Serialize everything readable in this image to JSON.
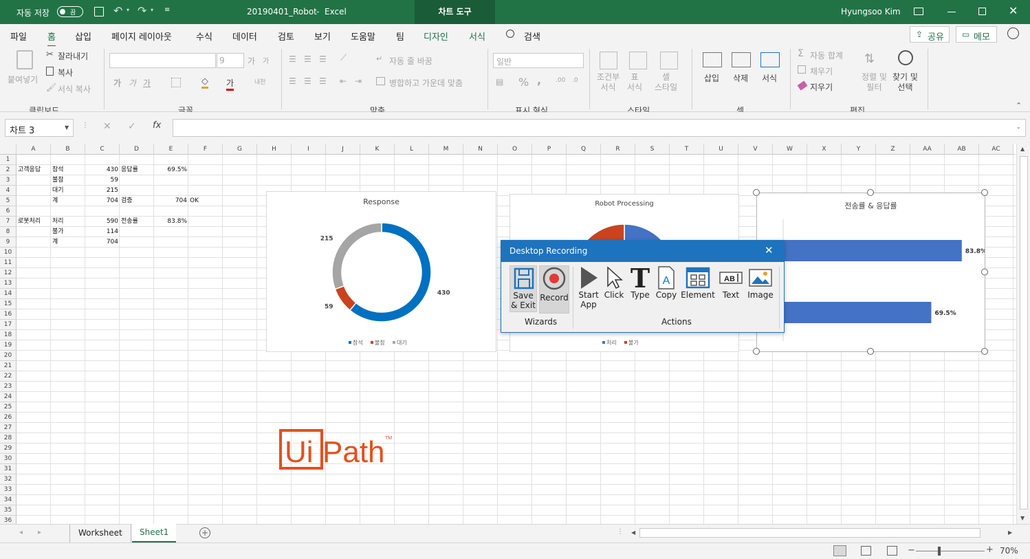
{
  "titlebar": {
    "autosave_label": "자동 저장",
    "autosave_state": "끔",
    "filename": "20190401_Robot",
    "separator": "-",
    "app": "Excel",
    "context_tab": "차트 도구",
    "user": "Hyungsoo Kim"
  },
  "menu": {
    "tabs": [
      "파일",
      "홈",
      "삽입",
      "페이지 레이아웃",
      "수식",
      "데이터",
      "검토",
      "보기",
      "도움말",
      "팀",
      "디자인",
      "서식"
    ],
    "search": "검색",
    "share": "공유",
    "memo": "메모"
  },
  "ribbon": {
    "clipboard": {
      "paste": "붙여넣기",
      "cut": "잘라내기",
      "copy": "복사",
      "format_painter": "서식 복사",
      "group": "클립보드"
    },
    "font": {
      "size": "9",
      "grow": "가",
      "shrink": "가",
      "bold": "가",
      "italic": "가",
      "underline": "가",
      "ruby": "내천",
      "font_color": "가",
      "group": "글꼴"
    },
    "alignment": {
      "wrap": "자동 줄 바꿈",
      "merge": "병합하고 가운데 맞춤",
      "group": "맞춤"
    },
    "number": {
      "format": "일반",
      "percent": "%",
      "comma": ",",
      "group": "표시 형식"
    },
    "styles": {
      "conditional": "조건부\n서식",
      "table": "표\n서식",
      "cell": "셀\n스타일",
      "group": "스타일"
    },
    "cells": {
      "insert": "삽입",
      "delete": "삭제",
      "format": "서식",
      "group": "셀"
    },
    "editing": {
      "autosum": "자동 합계",
      "fill": "채우기",
      "clear": "지우기",
      "sort": "정렬 및\n필터",
      "find": "찾기 및\n선택",
      "group": "편집"
    }
  },
  "formula": {
    "namebox": "차트 3",
    "fx": "fx",
    "value": ""
  },
  "columns": [
    "A",
    "B",
    "C",
    "D",
    "E",
    "F",
    "G",
    "H",
    "I",
    "J",
    "K",
    "L",
    "M",
    "N",
    "O",
    "P",
    "Q",
    "R",
    "S",
    "T",
    "U",
    "V",
    "W",
    "X",
    "Y",
    "Z",
    "AA",
    "AB",
    "AC"
  ],
  "rows": [
    "1",
    "2",
    "3",
    "4",
    "5",
    "6",
    "7",
    "8",
    "9",
    "10",
    "11",
    "12",
    "13",
    "14",
    "15",
    "16",
    "17",
    "18",
    "19",
    "20",
    "21",
    "22",
    "23",
    "24",
    "25",
    "26",
    "27",
    "28",
    "29",
    "30",
    "31",
    "32",
    "33",
    "34",
    "35",
    "36"
  ],
  "cells": {
    "a2": "고객응답",
    "b2": "참석",
    "c2": "430",
    "d2": "응답률",
    "e2": "69.5%",
    "b3": "불참",
    "c3": "59",
    "b4": "대기",
    "c4": "215",
    "b5": "계",
    "c5": "704",
    "d5": "검증",
    "e5": "704",
    "f5": "OK",
    "a7": "로봇처리",
    "b7": "처리",
    "c7": "590",
    "d7": "전송률",
    "e7": "83.8%",
    "b8": "불가",
    "c8": "114",
    "b9": "계",
    "c9": "704"
  },
  "chart_data": [
    {
      "type": "pie",
      "title": "Response",
      "categories": [
        "참석",
        "불참",
        "대기"
      ],
      "values": [
        430,
        59,
        215
      ],
      "colors": [
        "#0070c0",
        "#c9431f",
        "#a5a5a5"
      ],
      "legend": "bottom",
      "donut": true
    },
    {
      "type": "pie",
      "title": "Robot Processing",
      "categories": [
        "처리",
        "불가"
      ],
      "values": [
        590,
        114
      ],
      "colors": [
        "#4472c4",
        "#c9431f"
      ],
      "legend": "bottom"
    },
    {
      "type": "bar",
      "title": "전송률 & 응답률",
      "categories": [
        "전송률",
        "응답률"
      ],
      "values": [
        83.8,
        69.5
      ],
      "value_labels": [
        "83.8%",
        "69.5%"
      ],
      "color": "#4472c4",
      "orientation": "horizontal",
      "xlim": [
        0,
        100
      ]
    }
  ],
  "dialog": {
    "title": "Desktop Recording",
    "save": "Save\n& Exit",
    "record": "Record",
    "wizards_label": "Wizards",
    "start_app": "Start\nApp",
    "click": "Click",
    "type": "Type",
    "copy": "Copy",
    "element": "Element",
    "text": "Text",
    "image": "Image",
    "actions_label": "Actions"
  },
  "logo": {
    "text": "UiPath",
    "tm": "TM",
    "color": "#e4501c"
  },
  "sheets": {
    "tabs": [
      "Worksheet",
      "Sheet1"
    ],
    "active": "Sheet1"
  },
  "status": {
    "zoom": "70%"
  }
}
